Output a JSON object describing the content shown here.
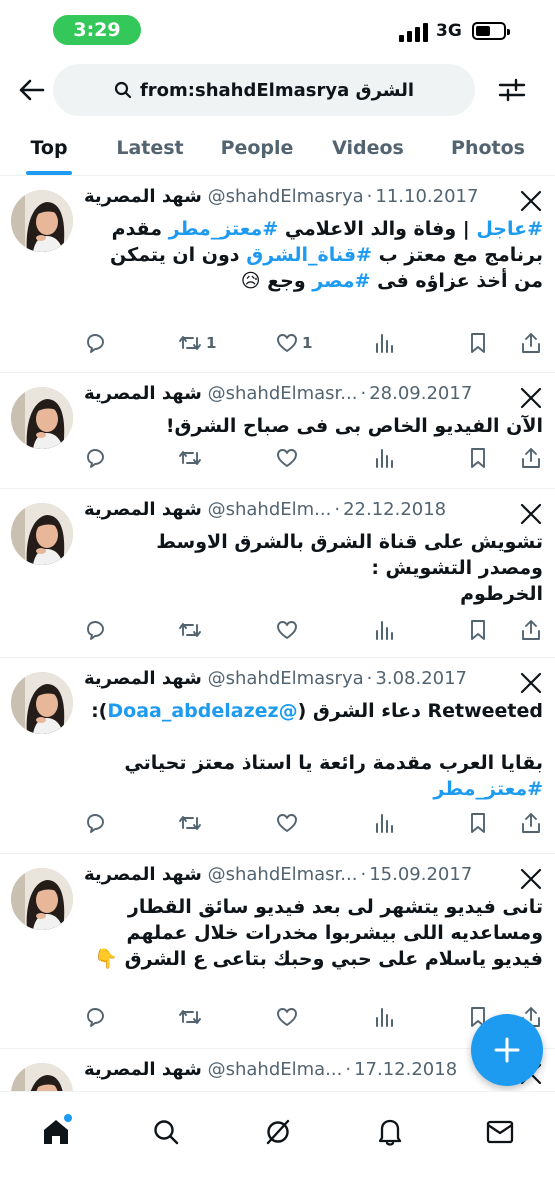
{
  "status_bar": {
    "time": "3:29",
    "network": "3G",
    "time_pill_color": "#34c759"
  },
  "search": {
    "query": "from:shahdElmasrya الشرق"
  },
  "tabs": [
    {
      "label": "Top",
      "active": true
    },
    {
      "label": "Latest",
      "active": false
    },
    {
      "label": "People",
      "active": false
    },
    {
      "label": "Videos",
      "active": false
    },
    {
      "label": "Photos",
      "active": false
    }
  ],
  "tweets": [
    {
      "name": "شهد المصرية",
      "handle": "@shahdElmasrya",
      "date": "11.10.2017",
      "text_html": "<span class=\"tag\">#عاجل</span> | وفاة والد الاعلامي <span class=\"tag\">#معتز_مطر</span> مقدم برنامج مع معتز ب <span class=\"tag\">#قناة_الشرق</span> دون ان يتمكن من أخذ عزاؤه فى <span class=\"tag\">#مصر</span> وجع 😥",
      "replies": "",
      "retweets": "1",
      "likes": "1"
    },
    {
      "name": "شهد المصرية",
      "handle": "@shahdElmasr...",
      "date": "28.09.2017",
      "text_html": "الآن الفيديو الخاص بى فى صباح الشرق!",
      "replies": "",
      "retweets": "",
      "likes": ""
    },
    {
      "name": "شهد المصرية",
      "handle": "@shahdElm...",
      "date": "22.12.2018",
      "text_html": "تشويش على قناة الشرق بالشرق الاوسط<br>ومصدر التشويش :<br>الخرطوم",
      "replies": "",
      "retweets": "",
      "likes": ""
    },
    {
      "name": "شهد المصرية",
      "handle": "@shahdElmasrya",
      "date": "3.08.2017",
      "text_html": "Retweeted دعاء الشرق (<span class=\"tag\">@Doaa_abdelazez</span>):<br><br>بقايا العرب مقدمة رائعة يا استاذ معتز تحياتي<br><span class=\"tag\">#معتز_مطر</span>",
      "replies": "",
      "retweets": "",
      "likes": ""
    },
    {
      "name": "شهد المصرية",
      "handle": "@shahdElmasr...",
      "date": "15.09.2017",
      "text_html": "تانى فيديو يتشهر لى بعد فيديو سائق القطار ومساعديه اللى بيشربوا مخدرات خلال عملهم فيديو ياسلام على حبي وحبك بتاعى ع الشرق 👇",
      "replies": "",
      "retweets": "",
      "likes": ""
    },
    {
      "name": "شهد المصرية",
      "handle": "@shahdElma...",
      "date": "17.12.2018",
      "text_html": "",
      "replies": "",
      "retweets": "",
      "likes": ""
    }
  ],
  "colors": {
    "accent": "#1d9bf0",
    "muted": "#536471",
    "text": "#0f1419"
  },
  "bottom_nav": [
    "home-icon",
    "search-icon",
    "grok-icon",
    "notifications-icon",
    "messages-icon"
  ]
}
